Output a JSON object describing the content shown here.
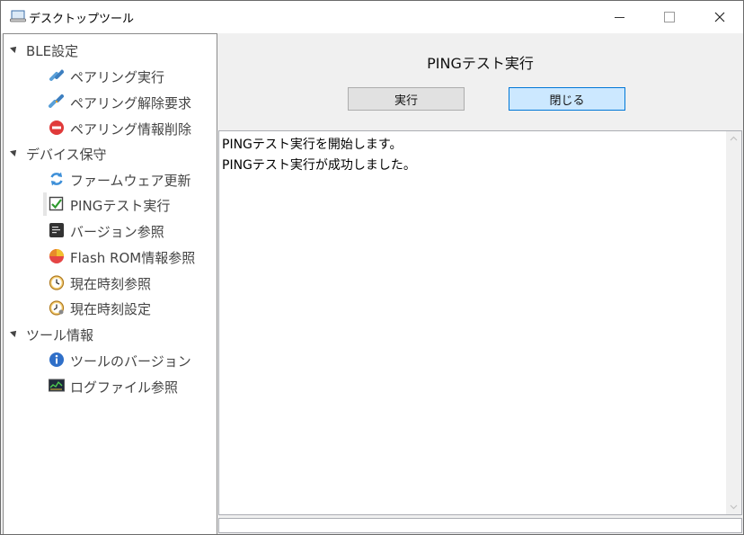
{
  "window": {
    "title": "デスクトップツール",
    "icon": "laptop-icon",
    "controls": [
      "minimize-icon",
      "maximize-icon",
      "close-icon"
    ]
  },
  "sidebar": {
    "groups": [
      {
        "label": "BLE設定",
        "items": [
          {
            "label": "ペアリング実行",
            "icon": "pairing-icon"
          },
          {
            "label": "ペアリング解除要求",
            "icon": "unpair-icon"
          },
          {
            "label": "ペアリング情報削除",
            "icon": "delete-icon"
          }
        ]
      },
      {
        "label": "デバイス保守",
        "items": [
          {
            "label": "ファームウェア更新",
            "icon": "refresh-icon"
          },
          {
            "label": "PINGテスト実行",
            "icon": "checkbox-icon",
            "selected": true
          },
          {
            "label": "バージョン参照",
            "icon": "terminal-icon"
          },
          {
            "label": "Flash ROM情報参照",
            "icon": "pie-chart-icon"
          },
          {
            "label": "現在時刻参照",
            "icon": "clock-icon"
          },
          {
            "label": "現在時刻設定",
            "icon": "clock-settings-icon"
          }
        ]
      },
      {
        "label": "ツール情報",
        "items": [
          {
            "label": "ツールのバージョン",
            "icon": "info-icon"
          },
          {
            "label": "ログファイル参照",
            "icon": "log-monitor-icon"
          }
        ]
      }
    ]
  },
  "main": {
    "title": "PINGテスト実行",
    "run_button": "実行",
    "close_button": "閉じる",
    "log_lines": [
      "PINGテスト実行を開始します。",
      "PINGテスト実行が成功しました。"
    ]
  },
  "colors": {
    "primary_button_bg": "#cce8ff",
    "primary_button_border": "#0078d7",
    "selected_item_bg": "#e5e5e5"
  }
}
